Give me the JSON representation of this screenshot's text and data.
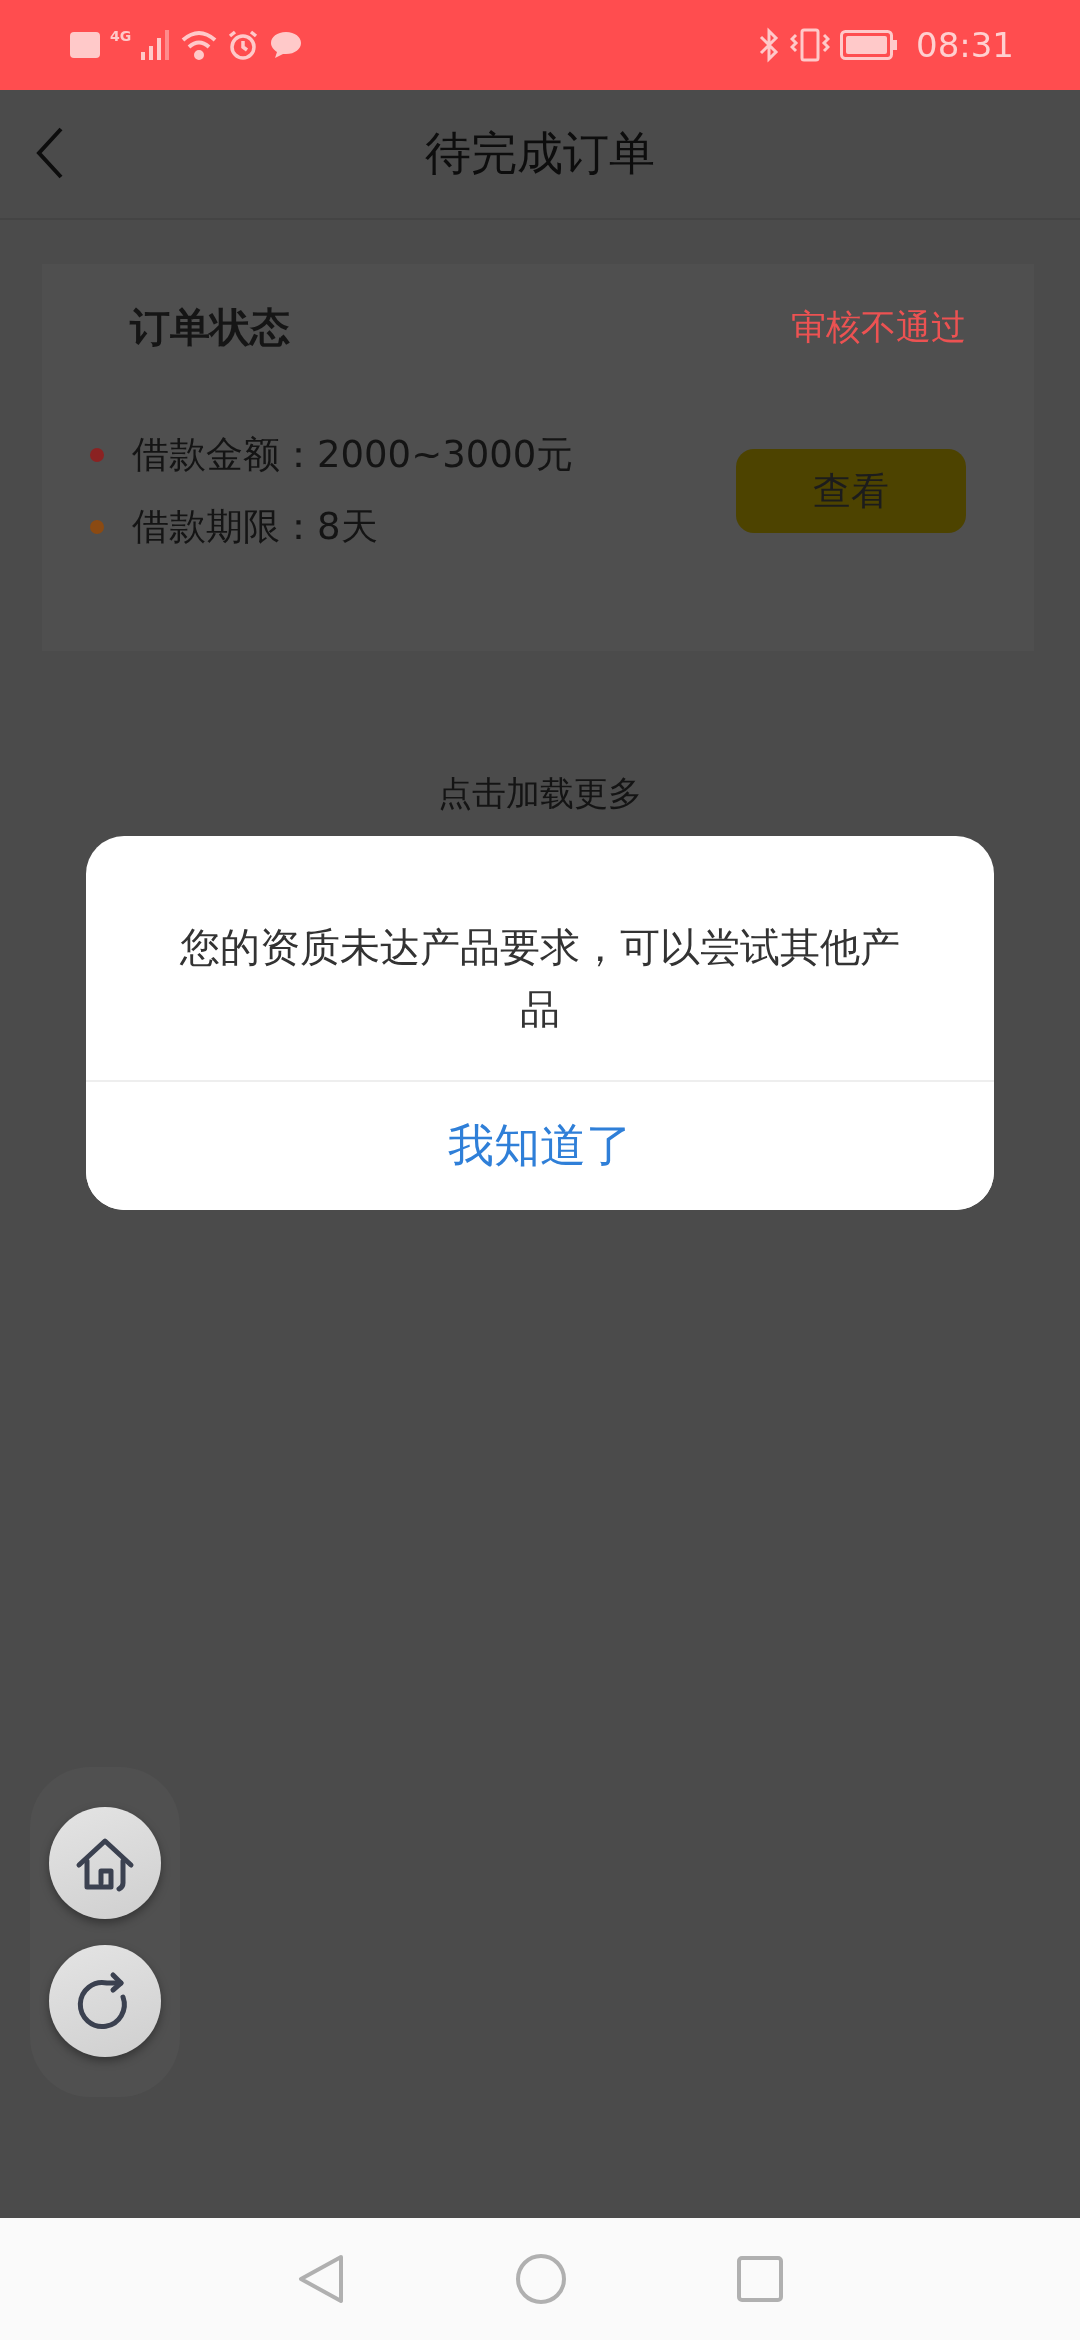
{
  "status_bar": {
    "time": "08:31",
    "network": "4G"
  },
  "header": {
    "title": "待完成订单"
  },
  "order_card": {
    "title": "订单状态",
    "status": "审核不通过",
    "details": [
      {
        "text": "借款金额：2000~3000元",
        "color": "#8b2222"
      },
      {
        "text": "借款期限：8天",
        "color": "#8b4a12"
      }
    ],
    "button": "查看"
  },
  "load_more": "点击加载更多",
  "dialog": {
    "message": "您的资质未达产品要求，可以尝试其他产品",
    "button": "我知道了"
  },
  "floating_actions": [
    {
      "kind": "home"
    },
    {
      "kind": "refresh"
    }
  ]
}
